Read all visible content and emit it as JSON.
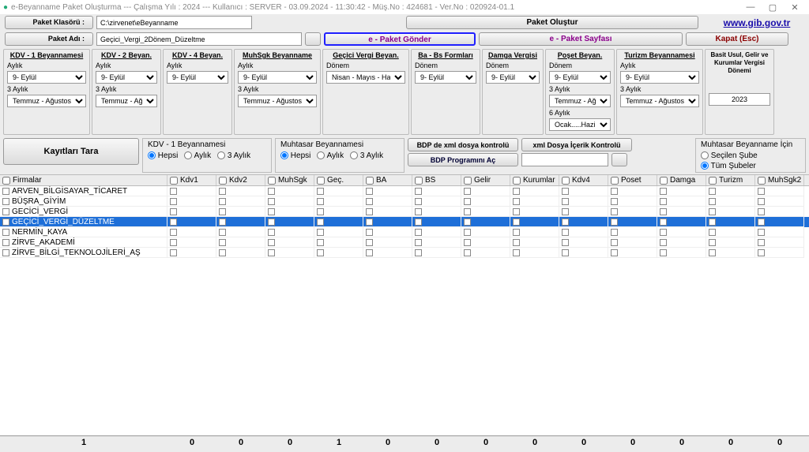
{
  "title": "e-Beyanname Paket Oluşturma  ---  Çalışma Yılı : 2024  ---  Kullanıcı : SERVER - 03.09.2024 -  11:30:42 - Müş.No : 424681 - Ver.No : 020924-01.1",
  "topLabels": {
    "klasor": "Paket Klasörü :",
    "adi": "Paket Adı :"
  },
  "inputs": {
    "klasor": "C:\\zirvenet\\eBeyanname",
    "adi": "Geçici_Vergi_2Dönem_Düzeltme"
  },
  "buttons": {
    "olustur": "Paket Oluştur",
    "gonder": "e - Paket Gönder",
    "sayfasi": "e - Paket Sayfası",
    "link": "www.gib.gov.tr",
    "kapat": "Kapat (Esc)",
    "tara": "Kayıtları Tara",
    "bdpKontrol": "BDP de xml dosya kontrolü",
    "xmlKontrol": "xml Dosya İçerik Kontrolü",
    "bdpAc": "BDP Programını Aç"
  },
  "cols": {
    "kdv1": {
      "hdr": "KDV - 1 Beyannamesi",
      "l1": "Aylık",
      "v1": "9- Eylül",
      "l2": "3 Aylık",
      "v2": "Temmuz - Ağustos - Eylül"
    },
    "kdv2": {
      "hdr": "KDV - 2 Beyan.",
      "l1": "Aylık",
      "v1": "9- Eylül",
      "l2": "3 Aylık",
      "v2": "Temmuz - Ağustc"
    },
    "kdv4": {
      "hdr": "KDV - 4 Beyan.",
      "l1": "Aylık",
      "v1": "9- Eylül"
    },
    "muhsgk": {
      "hdr": "MuhSgk Beyanname",
      "l1": "Aylık",
      "v1": "9- Eylül",
      "l2": "3 Aylık",
      "v2": "Temmuz - Ağustos - Eylül"
    },
    "gecici": {
      "hdr": "Geçici Vergi Beyan.",
      "l1": "Dönem",
      "v1": "Nisan - Mayıs - Haziran"
    },
    "babs": {
      "hdr": "Ba - Bs Formları",
      "l1": "Dönem",
      "v1": "9- Eylül"
    },
    "damga": {
      "hdr": "Damga Vergisi",
      "l1": "Dönem",
      "v1": "9- Eylül"
    },
    "poset": {
      "hdr": "Poşet Beyan.",
      "l1": "Dönem",
      "v1": "9- Eylül",
      "l2": "3 Aylık",
      "v2": "Temmuz - Ağustc",
      "l3": "6 Aylık",
      "v3": "Ocak.....Haziran"
    },
    "turizm": {
      "hdr": "Turizm Beyannamesi",
      "l1": "Aylık",
      "v1": "9- Eylül",
      "l2": "3 Aylık",
      "v2": "Temmuz - Ağustos - Eylül"
    },
    "basit": {
      "hdr": "Basit Usul, Gelir ve Kurumlar Vergisi Dönemi",
      "v1": "2023"
    }
  },
  "radios": {
    "kdv1b": {
      "tit": "KDV - 1 Beyannamesi",
      "r1": "Hepsi",
      "r2": "Aylık",
      "r3": "3 Aylık"
    },
    "muhb": {
      "tit": "Muhtasar Beyannamesi",
      "r1": "Hepsi",
      "r2": "Aylık",
      "r3": "3 Aylık"
    },
    "sube": {
      "tit": "Muhtasar Beyanname İçin",
      "r1": "Seçilen Şube",
      "r2": "Tüm Şubeler"
    }
  },
  "gridHdr": [
    "Firmalar",
    "Kdv1",
    "Kdv2",
    "MuhSgk",
    "Geç.",
    "BA",
    "BS",
    "Gelir",
    "Kurumlar",
    "Kdv4",
    "Poset",
    "Damga",
    "Turizm",
    "MuhSgk2"
  ],
  "firms": [
    "ARVEN_BİLGİSAYAR_TİCARET",
    "BÜŞRA_GİYİM",
    "GECİCİ_VERGİ",
    "GEÇİCİ_VERGİ_DÜZELTME",
    "NERMİN_KAYA",
    "ZİRVE_AKADEMİ",
    "ZİRVE_BİLGİ_TEKNOLOJİLERİ_AŞ"
  ],
  "selectedIndex": 3,
  "footer": [
    "1",
    "0",
    "0",
    "0",
    "1",
    "0",
    "0",
    "0",
    "0",
    "0",
    "0",
    "0",
    "0",
    "0"
  ]
}
